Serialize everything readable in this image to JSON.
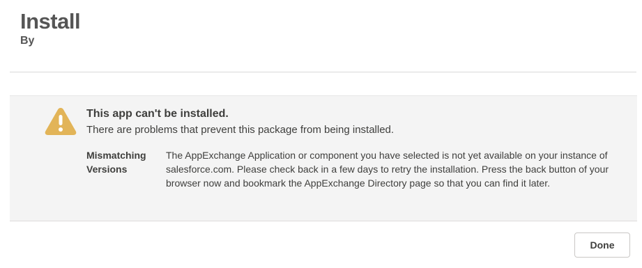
{
  "header": {
    "title": "Install",
    "subtitle": "By"
  },
  "error": {
    "icon": "warning-icon",
    "icon_color": "#e2b458",
    "title": "This app can't be installed.",
    "subtitle": "There are problems that prevent this package from being installed.",
    "detail_label": "Mismatching Versions",
    "detail_text": "The AppExchange Application or component you have selected is not yet available on your instance of salesforce.com. Please check back in a few days to retry the installation. Press the back button of your browser now and bookmark the AppExchange Directory page so that you can find it later."
  },
  "footer": {
    "done_label": "Done"
  }
}
